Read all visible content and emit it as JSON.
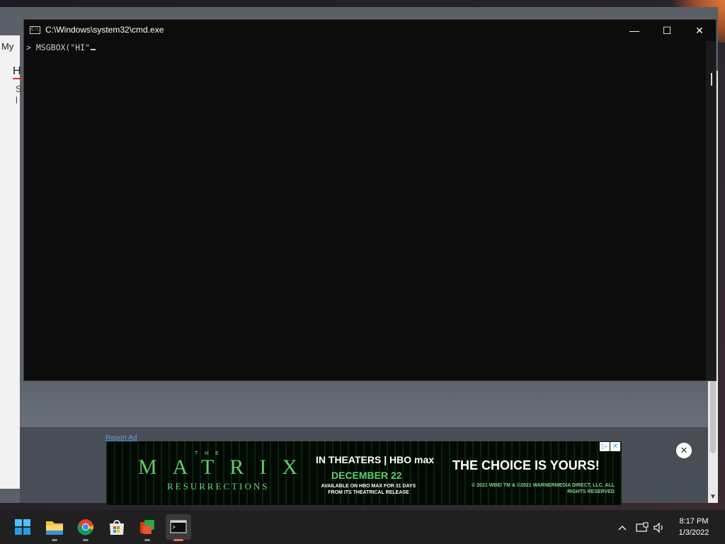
{
  "background": {
    "partial_text_my": "My",
    "partial_text_h": "H",
    "partial_text_s": "S",
    "partial_text_l": "l",
    "report_ad": "Report Ad",
    "ad": {
      "the": "T H E",
      "matrix": "MATRIX",
      "resurrections": "RESURRECTIONS",
      "in_theaters": "IN THEATERS | HBO max",
      "date": "DECEMBER 22",
      "availability": "AVAILABLE ON HBO MAX FOR 31 DAYS FROM ITS THEATRICAL RELEASE",
      "tagline": "THE CHOICE IS YOURS!",
      "copyright": "© 2021 WBEI TM & ©2021 WARNERMEDIA DIRECT, LLC. ALL RIGHTS RESERVED",
      "info_glyph": "▷",
      "close_glyph": "✕"
    },
    "close_overlay_glyph": "✕"
  },
  "cmd_window": {
    "title": "C:\\Windows\\system32\\cmd.exe",
    "icon_text": "C:\\",
    "minimize_glyph": "—",
    "maximize_glyph": "☐",
    "close_glyph": "✕",
    "prompt": ">",
    "command_text": "MSGBOX(\"HI\""
  },
  "taskbar": {
    "icons": [
      "windows-start-icon",
      "file-explorer-icon",
      "chrome-icon",
      "microsoft-store-icon",
      "office-icon",
      "terminal-icon"
    ],
    "tray_chevron": "^",
    "time": "8:17 PM",
    "date": "1/3/2022"
  },
  "colors": {
    "terminal_bg": "#0c0c0c",
    "taskbar_bg": "#202020",
    "active_indicator": "#e87060",
    "ad_green": "#5fcf6a"
  }
}
